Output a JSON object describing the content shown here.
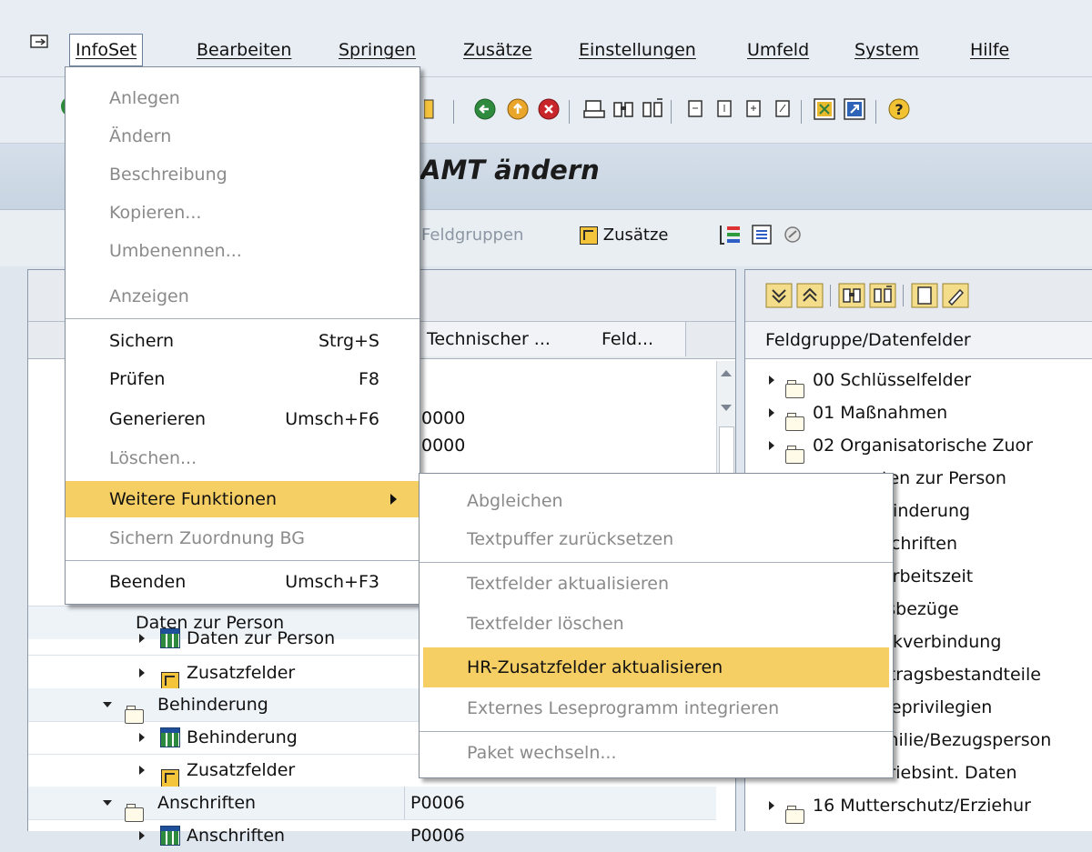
{
  "menubar": {
    "items": [
      "InfoSet",
      "Bearbeiten",
      "Springen",
      "Zusätze",
      "Einstellungen",
      "Umfeld",
      "System",
      "Hilfe"
    ]
  },
  "title": {
    "visible_fragment": "AMT ändern"
  },
  "app_toolbar": {
    "feldgruppen": "Feldgruppen",
    "zusaetze": "Zusätze"
  },
  "left_panel": {
    "columns": [
      "Technischer ...",
      "Feld..."
    ],
    "cells": [
      "0000",
      "0000"
    ],
    "tree": [
      {
        "label": "Daten zur Person",
        "icon": "grid-icon",
        "value": ""
      },
      {
        "label": "Zusatzfelder",
        "icon": "add-fields-icon",
        "value": ""
      },
      {
        "label": "Behinderung",
        "icon": "folder-icon",
        "value": ""
      },
      {
        "label": "Behinderung",
        "icon": "grid-icon",
        "value": ""
      },
      {
        "label": "Zusatzfelder",
        "icon": "add-fields-icon",
        "value": ""
      },
      {
        "label": "Anschriften",
        "icon": "folder-icon",
        "value": "P0006"
      },
      {
        "label": "Anschriften",
        "icon": "grid-icon",
        "value": "P0006"
      }
    ],
    "partial_hidden_label": "Daten zur Person"
  },
  "right_panel": {
    "header": "Feldgruppe/Datenfelder",
    "items": [
      "00 Schlüsselfelder",
      "01 Maßnahmen",
      "02 Organisatorische Zuor",
      "ten zur Person",
      "hinderung",
      "schriften",
      "arbeitszeit",
      "isbezüge",
      "nkverbindung",
      "rtragsbestandteile",
      "seprivilegien",
      "milie/Bezugsperson",
      "triebsint. Daten",
      "16 Mutterschutz/Erziehur"
    ]
  },
  "infoset_menu": {
    "items": [
      {
        "label": "Anlegen",
        "shortcut": "",
        "disabled": true
      },
      {
        "label": "Ändern",
        "shortcut": "",
        "disabled": true
      },
      {
        "label": "Beschreibung",
        "shortcut": "",
        "disabled": true
      },
      {
        "label": "Kopieren...",
        "shortcut": "",
        "disabled": true
      },
      {
        "label": "Umbenennen...",
        "shortcut": "",
        "disabled": true
      },
      {
        "label": "Anzeigen",
        "shortcut": "",
        "disabled": true
      },
      {
        "label": "Sichern",
        "shortcut": "Strg+S",
        "disabled": false
      },
      {
        "label": "Prüfen",
        "shortcut": "F8",
        "disabled": false
      },
      {
        "label": "Generieren",
        "shortcut": "Umsch+F6",
        "disabled": false
      },
      {
        "label": "Löschen...",
        "shortcut": "",
        "disabled": true
      },
      {
        "label": "Weitere Funktionen",
        "shortcut": "",
        "disabled": false
      },
      {
        "label": "Sichern Zuordnung BG",
        "shortcut": "",
        "disabled": true
      },
      {
        "label": "Beenden",
        "shortcut": "Umsch+F3",
        "disabled": false
      }
    ]
  },
  "submenu": {
    "items": [
      {
        "label": "Abgleichen",
        "disabled": true
      },
      {
        "label": "Textpuffer zurücksetzen",
        "disabled": true
      },
      {
        "label": "Textfelder aktualisieren",
        "disabled": true
      },
      {
        "label": "Textfelder löschen",
        "disabled": true
      },
      {
        "label": "HR-Zusatzfelder aktualisieren",
        "disabled": false
      },
      {
        "label": "Externes Leseprogramm integrieren",
        "disabled": true
      },
      {
        "label": "Paket wechseln...",
        "disabled": true
      }
    ]
  },
  "colors": {
    "highlight": "#f6cf64",
    "disabled_text": "#8a8a8a"
  }
}
